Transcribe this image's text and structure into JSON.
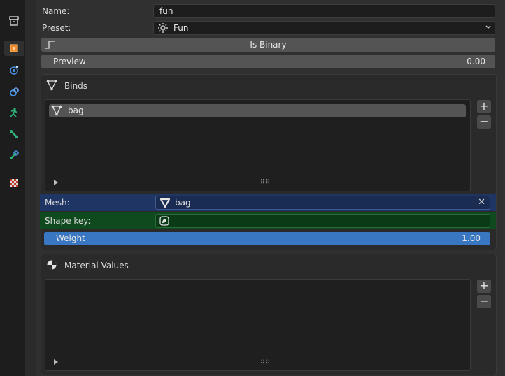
{
  "props": {
    "name_label": "Name:",
    "name_value": "fun",
    "preset_label": "Preset:",
    "preset_value": "Fun",
    "is_binary_label": "Is Binary",
    "preview_label": "Preview",
    "preview_value": "0.00"
  },
  "binds": {
    "title": "Binds",
    "items": [
      {
        "label": "bag"
      }
    ]
  },
  "bind_detail": {
    "mesh_label": "Mesh:",
    "mesh_value": "bag",
    "shape_key_label": "Shape key:",
    "weight_label": "Weight",
    "weight_value": "1.00"
  },
  "material_values": {
    "title": "Material Values"
  },
  "colors": {
    "accent_blue": "#3a77c2",
    "mesh_row_bg": "#1f3563",
    "shapekey_row_bg": "#0f4a1e",
    "list_selected": "#545454"
  },
  "icons": {
    "sidebar": [
      "archive-icon",
      "object-icon",
      "physics-icon",
      "constraint-icon",
      "armature-pose-icon",
      "bone-icon",
      "bone-constraint-icon",
      "texture-checker-icon"
    ]
  }
}
